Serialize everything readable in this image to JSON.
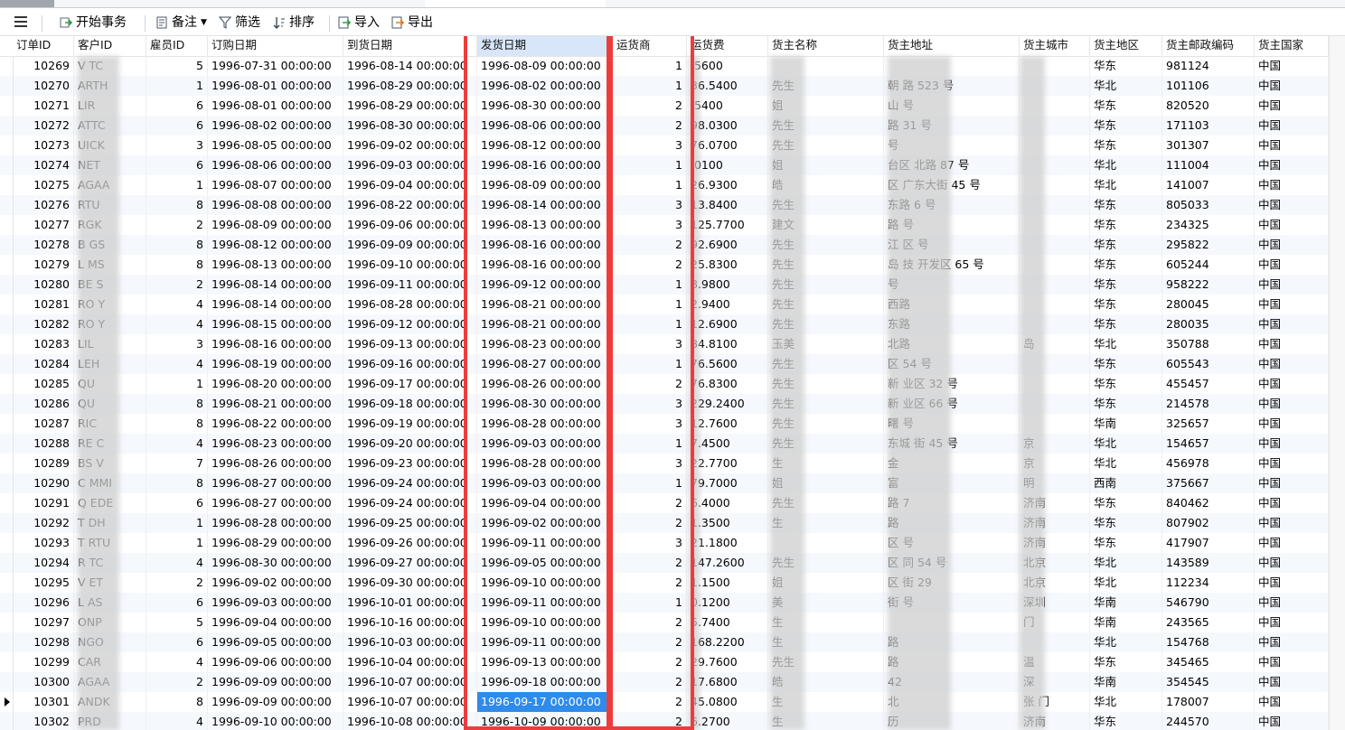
{
  "toolbar": {
    "menu_icon": "hamburger-menu-icon",
    "begin_transaction": "开始事务",
    "note": "备注",
    "filter": "筛选",
    "sort": "排序",
    "import": "导入",
    "export": "导出"
  },
  "columns": [
    "订单ID",
    "客户ID",
    "雇员ID",
    "订购日期",
    "到货日期",
    "发货日期",
    "运货商",
    "运货费",
    "货主名称",
    "货主地址",
    "货主城市",
    "货主地区",
    "货主邮政编码",
    "货主国家"
  ],
  "rows": [
    [
      "10269",
      "V  TC",
      "5",
      "1996-07-31 00:00:00",
      "1996-08-14 00:00:00",
      "1996-08-09 00:00:00",
      "1",
      ".5600",
      "",
      "",
      "",
      "华东",
      "981124",
      "中国"
    ],
    [
      "10270",
      "  ARTH",
      "1",
      "1996-08-01 00:00:00",
      "1996-08-29 00:00:00",
      "1996-08-02 00:00:00",
      "1",
      "36.5400",
      "先生",
      "朝     路 523 号",
      "",
      "华北",
      "101106",
      "中国"
    ],
    [
      "10271",
      "  LIR",
      "6",
      "1996-08-01 00:00:00",
      "1996-08-29 00:00:00",
      "1996-08-30 00:00:00",
      "2",
      ".5400",
      "姐",
      "山       号",
      "",
      "华东",
      "820520",
      "中国"
    ],
    [
      "10272",
      "  ATTC",
      "6",
      "1996-08-02 00:00:00",
      "1996-08-30 00:00:00",
      "1996-08-06 00:00:00",
      "2",
      "98.0300",
      "先生",
      "      路 31 号",
      "",
      "华东",
      "171103",
      "中国"
    ],
    [
      "10273",
      "  UICK",
      "3",
      "1996-08-05 00:00:00",
      "1996-09-02 00:00:00",
      "1996-08-12 00:00:00",
      "3",
      "76.0700",
      "先生",
      "      号",
      "",
      "华东",
      "301307",
      "中国"
    ],
    [
      "10274",
      "  NET",
      "6",
      "1996-08-06 00:00:00",
      "1996-09-03 00:00:00",
      "1996-08-16 00:00:00",
      "1",
      ".0100",
      "姐",
      "  台区   北路 87 号",
      "",
      "华北",
      "111004",
      "中国"
    ],
    [
      "10275",
      "  AGAA",
      "1",
      "1996-08-07 00:00:00",
      "1996-09-04 00:00:00",
      "1996-08-09 00:00:00",
      "1",
      "26.9300",
      "皓",
      "     区  广东大街 45 号",
      "",
      "华北",
      "141007",
      "中国"
    ],
    [
      "10276",
      "  RTU",
      "8",
      "1996-08-08 00:00:00",
      "1996-08-22 00:00:00",
      "1996-08-14 00:00:00",
      "3",
      "13.8400",
      "先生",
      "     东路 6 号",
      "",
      "华东",
      "805033",
      "中国"
    ],
    [
      "10277",
      "  RGK",
      "2",
      "1996-08-09 00:00:00",
      "1996-09-06 00:00:00",
      "1996-08-13 00:00:00",
      "3",
      "125.7700",
      "建文",
      "     路   号",
      "",
      "华东",
      "234325",
      "中国"
    ],
    [
      "10278",
      "B  GS",
      "8",
      "1996-08-12 00:00:00",
      "1996-09-09 00:00:00",
      "1996-08-16 00:00:00",
      "2",
      "92.6900",
      "先生",
      "    江   区  号",
      "",
      "华东",
      "295822",
      "中国"
    ],
    [
      "10279",
      "L  MS",
      "8",
      "1996-08-13 00:00:00",
      "1996-09-10 00:00:00",
      "1996-08-16 00:00:00",
      "2",
      "25.8300",
      "先生",
      "    岛   技  开发区 65 号",
      "",
      "华东",
      "605244",
      "中国"
    ],
    [
      "10280",
      "BE  S",
      "2",
      "1996-08-14 00:00:00",
      "1996-09-11 00:00:00",
      "1996-09-12 00:00:00",
      "1",
      "8.9800",
      "先生",
      "       号",
      "",
      "华东",
      "958222",
      "中国"
    ],
    [
      "10281",
      "RO  Y",
      "4",
      "1996-08-14 00:00:00",
      "1996-08-28 00:00:00",
      "1996-08-21 00:00:00",
      "1",
      "2.9400",
      "先生",
      "    西路",
      "",
      "华东",
      "280045",
      "中国"
    ],
    [
      "10282",
      "RO  Y",
      "4",
      "1996-08-15 00:00:00",
      "1996-09-12 00:00:00",
      "1996-08-21 00:00:00",
      "1",
      "12.6900",
      "先生",
      "    东路",
      "",
      "华东",
      "280035",
      "中国"
    ],
    [
      "10283",
      "LIL",
      "3",
      "1996-08-16 00:00:00",
      "1996-09-13 00:00:00",
      "1996-08-23 00:00:00",
      "3",
      "84.8100",
      "玉美",
      "    北路",
      "    岛",
      "华北",
      "350788",
      "中国"
    ],
    [
      "10284",
      "LEH",
      "4",
      "1996-08-19 00:00:00",
      "1996-09-16 00:00:00",
      "1996-08-27 00:00:00",
      "1",
      "76.5600",
      "先生",
      "       区    54 号",
      "",
      "华东",
      "605543",
      "中国"
    ],
    [
      "10285",
      "QU",
      "1",
      "1996-08-20 00:00:00",
      "1996-09-17 00:00:00",
      "1996-08-26 00:00:00",
      "2",
      "76.8300",
      "先生",
      "新    业区 32 号",
      "",
      "华东",
      "455457",
      "中国"
    ],
    [
      "10286",
      "QU",
      "8",
      "1996-08-21 00:00:00",
      "1996-09-18 00:00:00",
      "1996-08-30 00:00:00",
      "3",
      "229.2400",
      "先生",
      "新    业区 66 号",
      "",
      "华东",
      "214578",
      "中国"
    ],
    [
      "10287",
      "RIC",
      "8",
      "1996-08-22 00:00:00",
      "1996-09-19 00:00:00",
      "1996-08-28 00:00:00",
      "3",
      "12.7600",
      "先生",
      "曙      号",
      "",
      "华南",
      "325657",
      "中国"
    ],
    [
      "10288",
      "RE  C",
      "4",
      "1996-08-23 00:00:00",
      "1996-09-20 00:00:00",
      "1996-09-03 00:00:00",
      "1",
      "7.4500",
      "先生",
      "东城   街 45 号",
      "  京",
      "华北",
      "154657",
      "中国"
    ],
    [
      "10289",
      "BS  V",
      "7",
      "1996-08-26 00:00:00",
      "1996-09-23 00:00:00",
      "1996-08-28 00:00:00",
      "3",
      "22.7700",
      "生",
      "金",
      "  京",
      "华北",
      "456978",
      "中国"
    ],
    [
      "10290",
      "C  MMI",
      "8",
      "1996-08-27 00:00:00",
      "1996-09-24 00:00:00",
      "1996-09-03 00:00:00",
      "1",
      "79.7000",
      "姐",
      "富",
      "  明",
      "西南",
      "375667",
      "中国"
    ],
    [
      "10291",
      "Q  EDE",
      "6",
      "1996-08-27 00:00:00",
      "1996-09-24 00:00:00",
      "1996-09-04 00:00:00",
      "2",
      "6.4000",
      "先生",
      "      路 7",
      "济南",
      "华东",
      "840462",
      "中国"
    ],
    [
      "10292",
      "T  DH",
      "1",
      "1996-08-28 00:00:00",
      "1996-09-25 00:00:00",
      "1996-09-02 00:00:00",
      "2",
      "1.3500",
      "生",
      "      路",
      "济南",
      "华东",
      "807902",
      "中国"
    ],
    [
      "10293",
      "T  RTU",
      "1",
      "1996-08-29 00:00:00",
      "1996-09-26 00:00:00",
      "1996-09-11 00:00:00",
      "3",
      "21.1800",
      "",
      "    区    号",
      "济南",
      "华东",
      "417907",
      "中国"
    ],
    [
      "10294",
      "R  TC",
      "4",
      "1996-08-30 00:00:00",
      "1996-09-27 00:00:00",
      "1996-09-05 00:00:00",
      "2",
      "147.2600",
      "先生",
      "    区   同 54 号",
      "北京",
      "华北",
      "143589",
      "中国"
    ],
    [
      "10295",
      "V  ET",
      "2",
      "1996-09-02 00:00:00",
      "1996-09-30 00:00:00",
      "1996-09-10 00:00:00",
      "2",
      "1.1500",
      "姐",
      "    区   街 29",
      "北京",
      "华北",
      "112234",
      "中国"
    ],
    [
      "10296",
      "L  AS",
      "6",
      "1996-09-03 00:00:00",
      "1996-10-01 00:00:00",
      "1996-09-11 00:00:00",
      "1",
      "0.1200",
      "美",
      "      街   号",
      "深圳",
      "华南",
      "546790",
      "中国"
    ],
    [
      "10297",
      "  ONP",
      "5",
      "1996-09-04 00:00:00",
      "1996-10-16 00:00:00",
      "1996-09-10 00:00:00",
      "2",
      "5.7400",
      "生",
      "",
      "  门",
      "华南",
      "243565",
      "中国"
    ],
    [
      "10298",
      "  NGO",
      "6",
      "1996-09-05 00:00:00",
      "1996-10-03 00:00:00",
      "1996-09-11 00:00:00",
      "2",
      "168.2200",
      "生",
      "    路",
      "",
      "华北",
      "154768",
      "中国"
    ],
    [
      "10299",
      "  CAR",
      "4",
      "1996-09-06 00:00:00",
      "1996-10-04 00:00:00",
      "1996-09-13 00:00:00",
      "2",
      "29.7600",
      "先生",
      "    路",
      "  温",
      "华东",
      "345465",
      "中国"
    ],
    [
      "10300",
      "  AGAA",
      "2",
      "1996-09-09 00:00:00",
      "1996-10-07 00:00:00",
      "1996-09-18 00:00:00",
      "2",
      "17.6800",
      "皓",
      "      42",
      "  深",
      "华南",
      "354545",
      "中国"
    ],
    [
      "10301",
      "  ANDK",
      "8",
      "1996-09-09 00:00:00",
      "1996-10-07 00:00:00",
      "1996-09-17 00:00:00",
      "2",
      "45.0800",
      "生",
      "北",
      "  张  门",
      "华北",
      "178007",
      "中国"
    ],
    [
      "10302",
      "  PRD",
      "4",
      "1996-09-10 00:00:00",
      "1996-10-08 00:00:00",
      "1996-10-09 00:00:00",
      "2",
      "6.2700",
      "生",
      "历",
      "济南",
      "华东",
      "244570",
      "中国"
    ]
  ]
}
